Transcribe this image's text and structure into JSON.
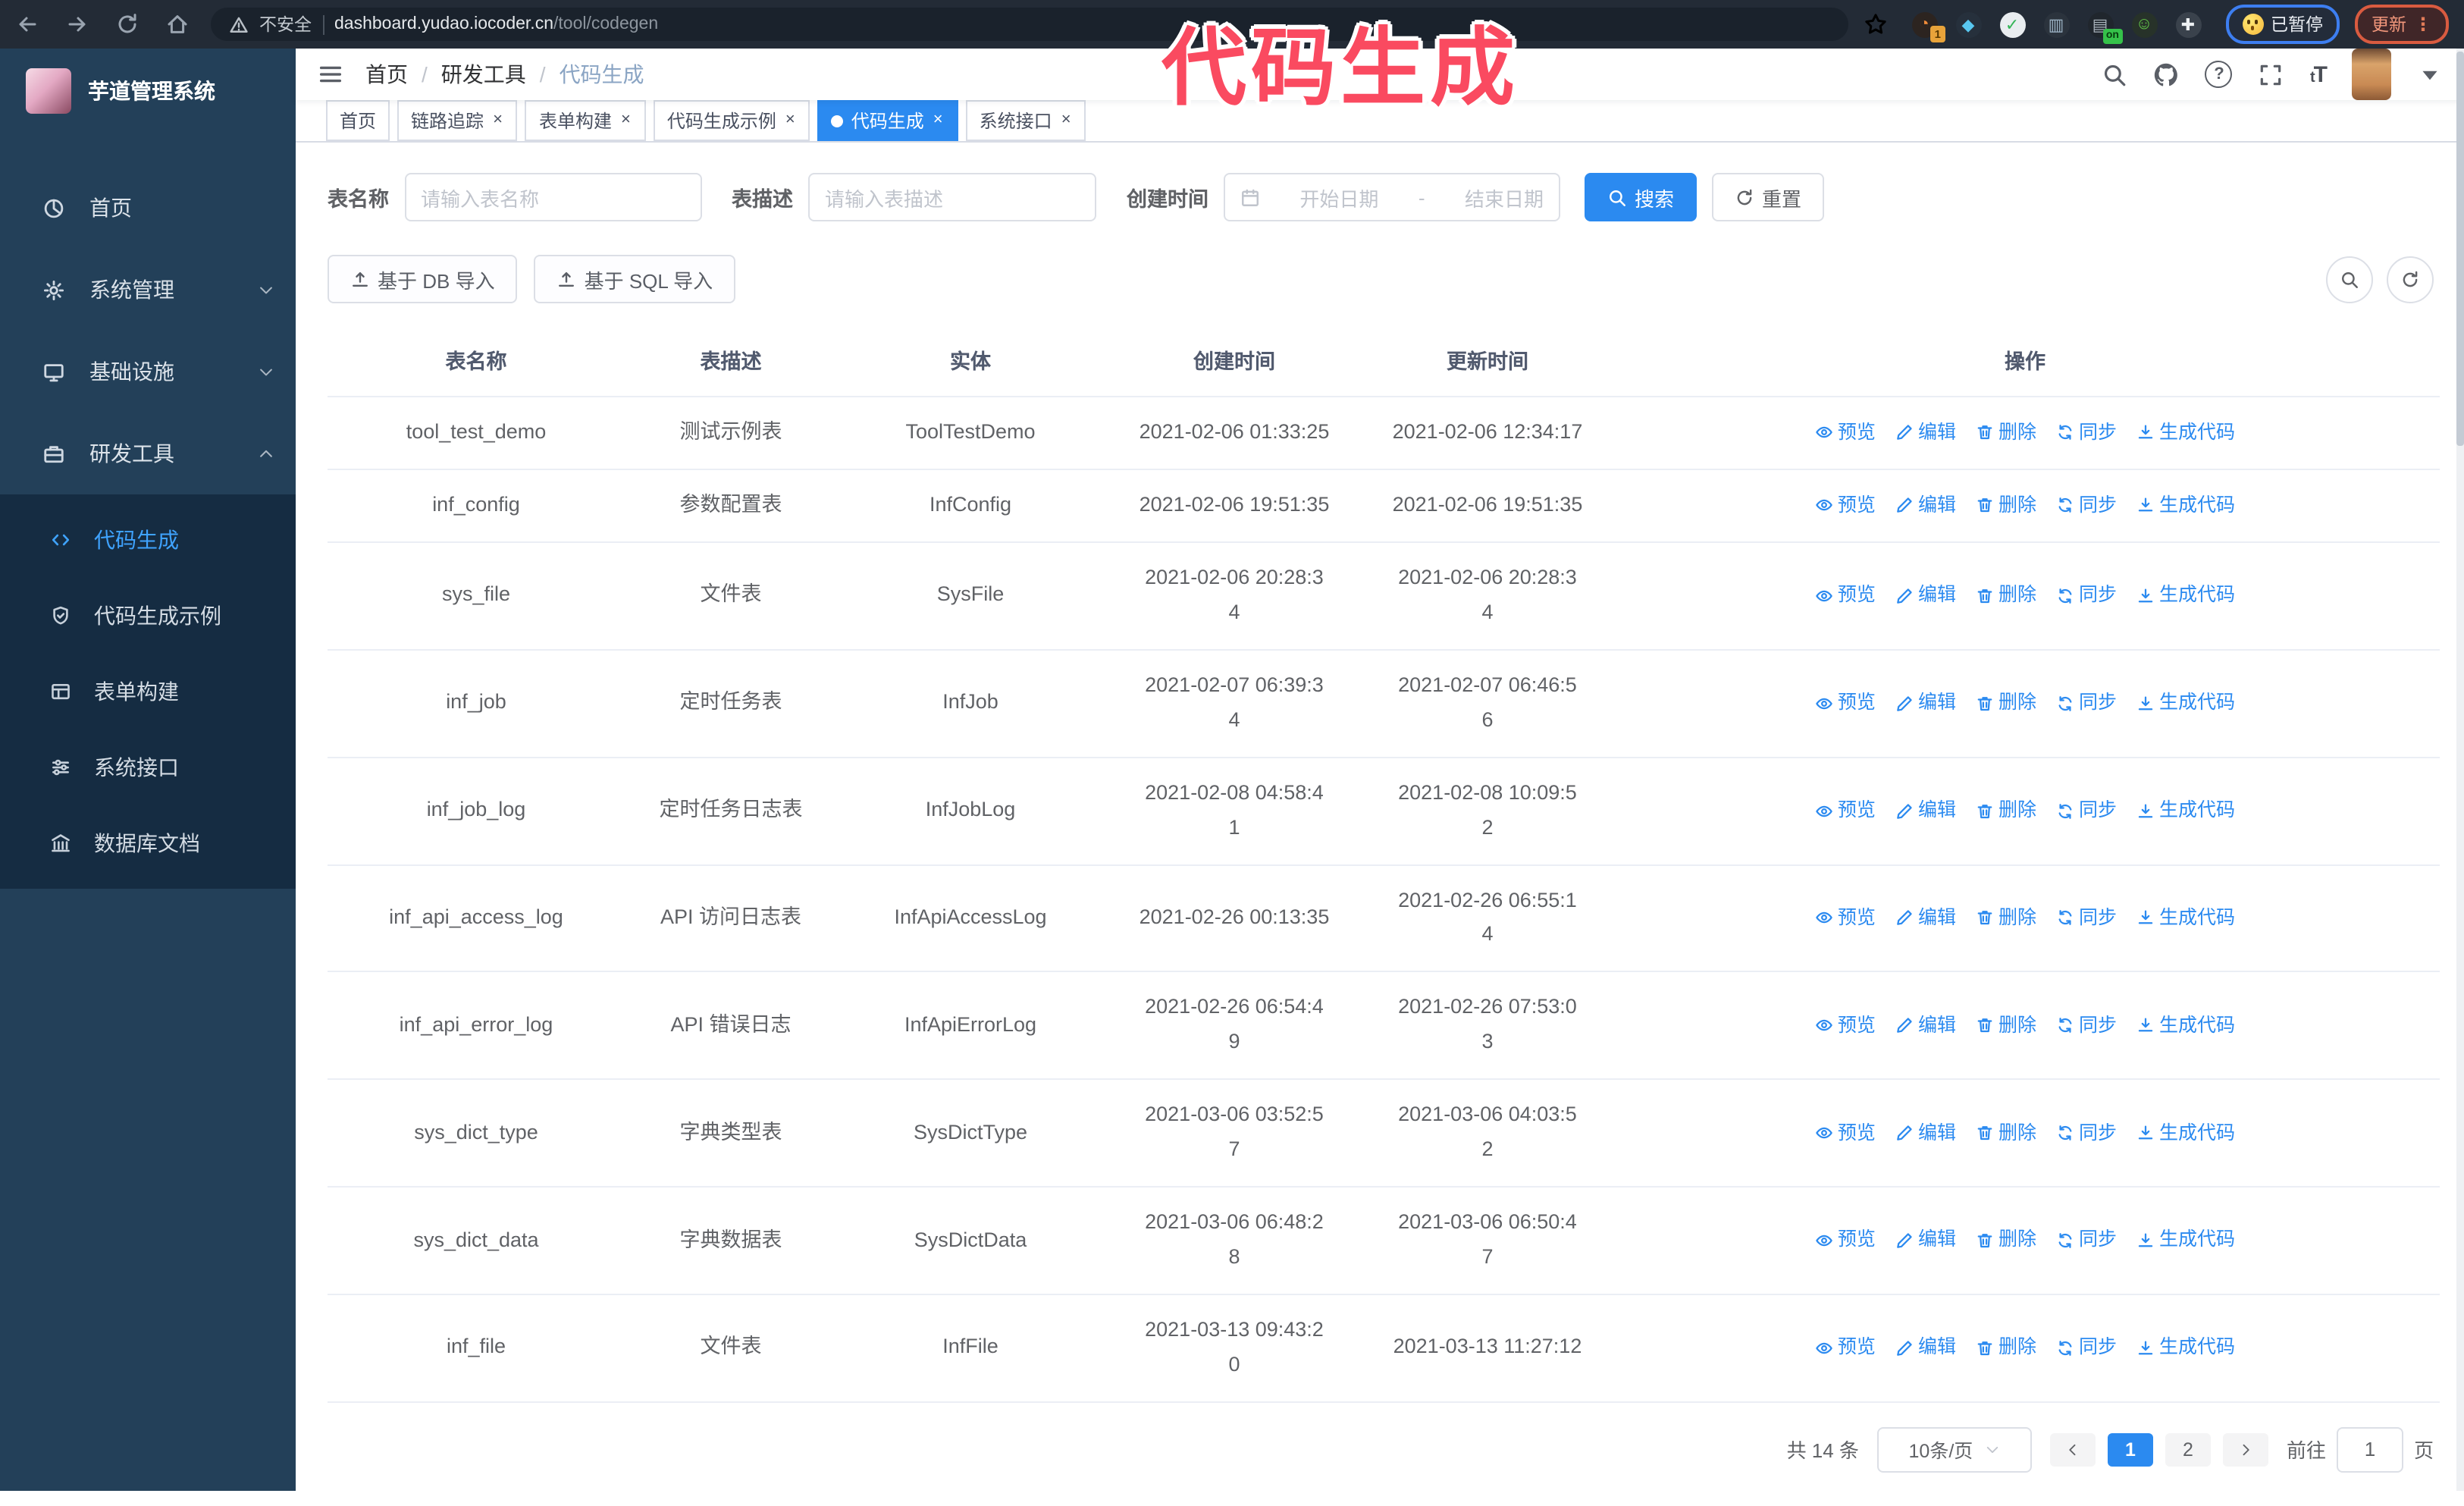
{
  "browser": {
    "security_label": "不安全",
    "url_host": "dashboard.yudao.iocoder.cn",
    "url_path": "/tool/codegen",
    "paused_label": "已暂停",
    "update_label": "更新",
    "more_dots": "⋮",
    "extensions": [
      {
        "name": "ext-orange-circle",
        "glyph": "◔",
        "fg": "#f08c3a",
        "bg": "#2c2420",
        "badge": "1"
      },
      {
        "name": "ext-gem",
        "glyph": "◆",
        "fg": "#58c7f0",
        "bg": "#26303c"
      },
      {
        "name": "ext-green-check",
        "glyph": "✓",
        "fg": "#35b558",
        "bg": "#e9edf0"
      },
      {
        "name": "ext-bars",
        "glyph": "▥",
        "fg": "#9fb6c8",
        "bg": "#2b333d",
        "tag": null
      },
      {
        "name": "ext-dark-on",
        "glyph": "▤",
        "fg": "#aab4bd",
        "bg": "#20262d",
        "tag": "on"
      },
      {
        "name": "ext-monkey",
        "glyph": "☺",
        "fg": "#63c74a",
        "bg": "#273229"
      },
      {
        "name": "ext-puzzle",
        "glyph": "✚",
        "fg": "#eef1f3",
        "bg": "#3a424c"
      }
    ]
  },
  "overlay": {
    "text": "代码生成",
    "color": "#fa4a60"
  },
  "sidebar": {
    "app_title": "芋道管理系统",
    "items": [
      {
        "label": "首页",
        "icon": "pie",
        "expand": null
      },
      {
        "label": "系统管理",
        "icon": "gear",
        "expand": "down"
      },
      {
        "label": "基础设施",
        "icon": "monitor",
        "expand": "down"
      },
      {
        "label": "研发工具",
        "icon": "tool",
        "expand": "up"
      }
    ],
    "submenu": [
      {
        "label": "代码生成",
        "icon": "code",
        "active": true
      },
      {
        "label": "代码生成示例",
        "icon": "shield",
        "active": false
      },
      {
        "label": "表单构建",
        "icon": "form",
        "active": false
      },
      {
        "label": "系统接口",
        "icon": "sliders",
        "active": false
      },
      {
        "label": "数据库文档",
        "icon": "db",
        "active": false
      }
    ]
  },
  "header": {
    "breadcrumb": [
      "首页",
      "研发工具",
      "代码生成"
    ]
  },
  "tabs": [
    {
      "label": "首页",
      "closable": false,
      "active": false
    },
    {
      "label": "链路追踪",
      "closable": true,
      "active": false
    },
    {
      "label": "表单构建",
      "closable": true,
      "active": false
    },
    {
      "label": "代码生成示例",
      "closable": true,
      "active": false
    },
    {
      "label": "代码生成",
      "closable": true,
      "active": true
    },
    {
      "label": "系统接口",
      "closable": true,
      "active": false
    }
  ],
  "ui": {
    "tab_close": "×"
  },
  "filters": {
    "name_label": "表名称",
    "name_placeholder": "请输入表名称",
    "desc_label": "表描述",
    "desc_placeholder": "请输入表描述",
    "time_label": "创建时间",
    "start_placeholder": "开始日期",
    "range_separator": "-",
    "end_placeholder": "结束日期",
    "search_label": "搜索",
    "reset_label": "重置"
  },
  "toolbar": {
    "import_db_label": "基于 DB 导入",
    "import_sql_label": "基于 SQL 导入"
  },
  "table": {
    "columns": [
      "表名称",
      "表描述",
      "实体",
      "创建时间",
      "更新时间",
      "操作"
    ],
    "actions": [
      "预览",
      "编辑",
      "删除",
      "同步",
      "生成代码"
    ],
    "action_icons": [
      "eye",
      "edit",
      "trash",
      "sync",
      "download"
    ],
    "rows": [
      {
        "name": "tool_test_demo",
        "desc": "测试示例表",
        "entity": "ToolTestDemo",
        "created": "2021-02-06 01:33:25",
        "updated": "2021-02-06 12:34:17"
      },
      {
        "name": "inf_config",
        "desc": "参数配置表",
        "entity": "InfConfig",
        "created": "2021-02-06 19:51:35",
        "updated": "2021-02-06 19:51:35"
      },
      {
        "name": "sys_file",
        "desc": "文件表",
        "entity": "SysFile",
        "created": "2021-02-06 20:28:3\n4",
        "updated": "2021-02-06 20:28:3\n4"
      },
      {
        "name": "inf_job",
        "desc": "定时任务表",
        "entity": "InfJob",
        "created": "2021-02-07 06:39:3\n4",
        "updated": "2021-02-07 06:46:5\n6"
      },
      {
        "name": "inf_job_log",
        "desc": "定时任务日志表",
        "entity": "InfJobLog",
        "created": "2021-02-08 04:58:4\n1",
        "updated": "2021-02-08 10:09:5\n2"
      },
      {
        "name": "inf_api_access_log",
        "desc": "API 访问日志表",
        "entity": "InfApiAccessLog",
        "created": "2021-02-26 00:13:35",
        "updated": "2021-02-26 06:55:1\n4"
      },
      {
        "name": "inf_api_error_log",
        "desc": "API 错误日志",
        "entity": "InfApiErrorLog",
        "created": "2021-02-26 06:54:4\n9",
        "updated": "2021-02-26 07:53:0\n3"
      },
      {
        "name": "sys_dict_type",
        "desc": "字典类型表",
        "entity": "SysDictType",
        "created": "2021-03-06 03:52:5\n7",
        "updated": "2021-03-06 04:03:5\n2"
      },
      {
        "name": "sys_dict_data",
        "desc": "字典数据表",
        "entity": "SysDictData",
        "created": "2021-03-06 06:48:2\n8",
        "updated": "2021-03-06 06:50:4\n7"
      },
      {
        "name": "inf_file",
        "desc": "文件表",
        "entity": "InfFile",
        "created": "2021-03-13 09:43:2\n0",
        "updated": "2021-03-13 11:27:12"
      }
    ]
  },
  "pagination": {
    "total": "共 14 条",
    "page_size": "10条/页",
    "pages": [
      "1",
      "2"
    ],
    "active_page": "1",
    "goto_label": "前往",
    "goto_value": "1",
    "goto_suffix": "页"
  },
  "colors": {
    "accent": "#2b8af0",
    "sidebar_bg": "#234059",
    "submenu_bg": "#152c42",
    "browser_bar_bg": "#232b36",
    "overlay_pink": "#fa4a60",
    "update_orange": "#d95b40",
    "paused_blue": "#3d7ef0"
  }
}
